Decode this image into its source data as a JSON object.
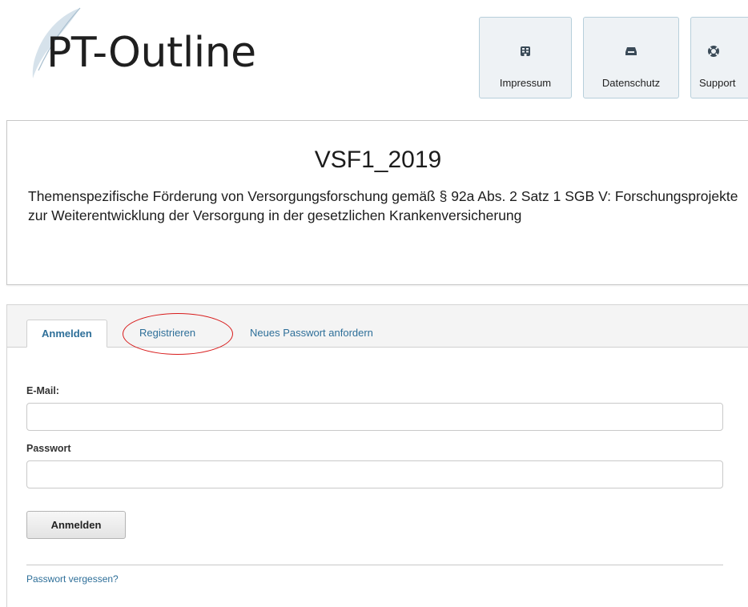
{
  "logo": {
    "text": "PT-Outline"
  },
  "nav": [
    {
      "label": "Impressum",
      "icon": "building-icon"
    },
    {
      "label": "Datenschutz",
      "icon": "inbox-icon"
    },
    {
      "label": "Support",
      "icon": "lifebuoy-icon"
    }
  ],
  "project": {
    "title": "VSF1_2019",
    "description": "Themenspezifische Förderung von Versorgungsforschung gemäß § 92a Abs. 2 Satz 1 SGB V: Forschungsprojekte zur Weiterentwicklung der Versorgung in der gesetzlichen Krankenversicherung"
  },
  "login": {
    "tabs": [
      {
        "label": "Anmelden",
        "active": true
      },
      {
        "label": "Registrieren",
        "active": false,
        "highlighted": true
      },
      {
        "label": "Neues Passwort anfordern",
        "active": false
      }
    ],
    "email_label": "E-Mail:",
    "email_value": "",
    "password_label": "Passwort",
    "password_value": "",
    "submit_label": "Anmelden",
    "forgot_link": "Passwort vergessen?"
  },
  "colors": {
    "link": "#2e6f99",
    "highlight": "#d81b1b",
    "nav_bg": "#eef2f5",
    "nav_border": "#b7cfdb"
  }
}
